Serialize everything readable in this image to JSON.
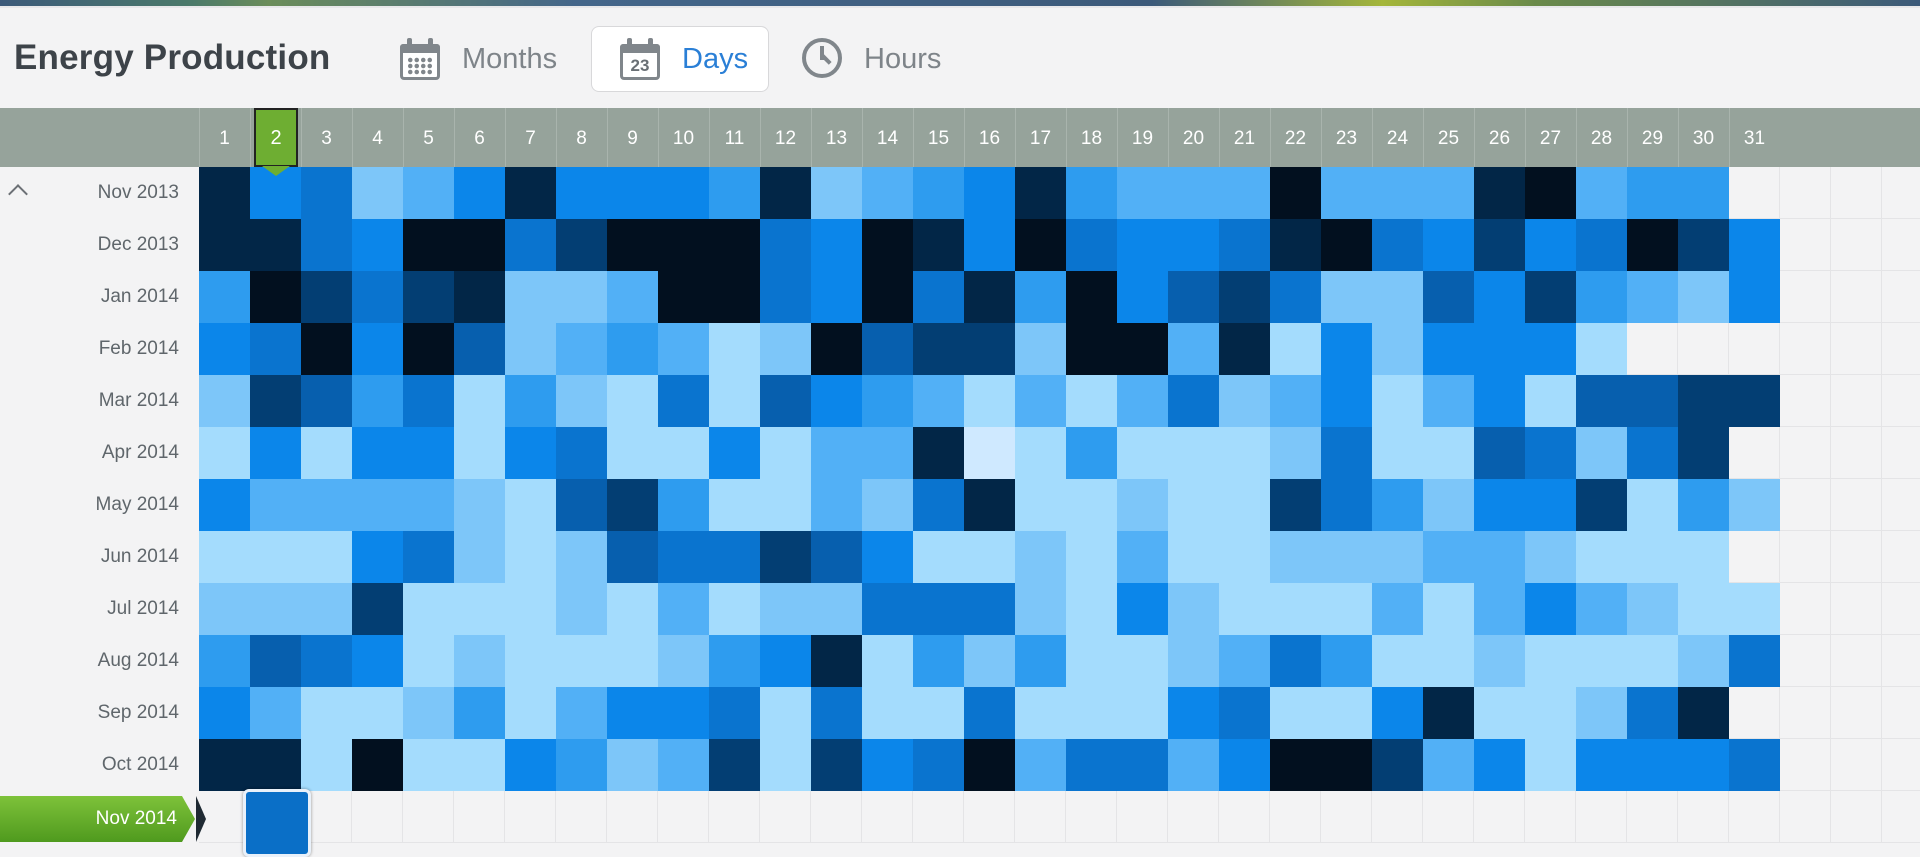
{
  "header": {
    "title": "Energy Production",
    "tabs": [
      {
        "label": "Months",
        "icon": "calendar-grid-icon",
        "active": false
      },
      {
        "label": "Days",
        "icon": "calendar-23-icon",
        "icon_text": "23",
        "active": true
      },
      {
        "label": "Hours",
        "icon": "clock-icon",
        "active": false
      }
    ]
  },
  "days": [
    "1",
    "2",
    "3",
    "4",
    "5",
    "6",
    "7",
    "8",
    "9",
    "10",
    "11",
    "12",
    "13",
    "14",
    "15",
    "16",
    "17",
    "18",
    "19",
    "20",
    "21",
    "22",
    "23",
    "24",
    "25",
    "26",
    "27",
    "28",
    "29",
    "30",
    "31"
  ],
  "selected_day": "2",
  "months": [
    "Nov 2013",
    "Dec 2013",
    "Jan 2014",
    "Feb 2014",
    "Mar 2014",
    "Apr 2014",
    "May 2014",
    "Jun 2014",
    "Jul 2014",
    "Aug 2014",
    "Sep 2014",
    "Oct 2014"
  ],
  "selected_month": "Nov 2014",
  "colors": {
    "accent_green": "#6eae32",
    "active_tab": "#2a7fd6",
    "header_bar": "#96a39b",
    "scale_low": "#cfe9ff",
    "scale_high": "#02101f"
  },
  "chart_data": {
    "type": "heatmap",
    "x": [
      "1",
      "2",
      "3",
      "4",
      "5",
      "6",
      "7",
      "8",
      "9",
      "10",
      "11",
      "12",
      "13",
      "14",
      "15",
      "16",
      "17",
      "18",
      "19",
      "20",
      "21",
      "22",
      "23",
      "24",
      "25",
      "26",
      "27",
      "28",
      "29",
      "30",
      "31"
    ],
    "y": [
      "Nov 2013",
      "Dec 2013",
      "Jan 2014",
      "Feb 2014",
      "Mar 2014",
      "Apr 2014",
      "May 2014",
      "Jun 2014",
      "Jul 2014",
      "Aug 2014",
      "Sep 2014",
      "Oct 2014",
      "Nov 2014"
    ],
    "scale": "intensity 0 (lightest) to 10 (darkest)",
    "values": [
      [
        9,
        5,
        6,
        2,
        3,
        5,
        9,
        5,
        5,
        5,
        4,
        9,
        2,
        3,
        4,
        5,
        9,
        4,
        3,
        3,
        3,
        10,
        3,
        3,
        3,
        9,
        10,
        3,
        4,
        4,
        null
      ],
      [
        9,
        9,
        6,
        5,
        10,
        10,
        6,
        8,
        10,
        10,
        10,
        6,
        5,
        10,
        9,
        5,
        10,
        6,
        5,
        5,
        6,
        9,
        10,
        6,
        5,
        8,
        5,
        6,
        10,
        8,
        5
      ],
      [
        4,
        10,
        8,
        6,
        8,
        9,
        2,
        2,
        3,
        10,
        10,
        6,
        5,
        10,
        6,
        9,
        4,
        10,
        5,
        7,
        8,
        6,
        2,
        2,
        7,
        5,
        8,
        4,
        3,
        2,
        5
      ],
      [
        5,
        6,
        10,
        5,
        10,
        7,
        2,
        3,
        4,
        3,
        1,
        2,
        10,
        7,
        8,
        8,
        2,
        10,
        10,
        3,
        9,
        1,
        5,
        2,
        5,
        5,
        5,
        1,
        null,
        null,
        null
      ],
      [
        2,
        8,
        7,
        4,
        6,
        1,
        4,
        2,
        1,
        6,
        1,
        7,
        5,
        4,
        3,
        1,
        3,
        1,
        3,
        6,
        2,
        3,
        5,
        1,
        3,
        5,
        1,
        7,
        7,
        8,
        8
      ],
      [
        1,
        5,
        1,
        5,
        5,
        1,
        5,
        6,
        1,
        1,
        5,
        1,
        3,
        3,
        9,
        0,
        1,
        4,
        1,
        1,
        1,
        2,
        6,
        1,
        1,
        7,
        6,
        2,
        6,
        8,
        null
      ],
      [
        5,
        3,
        3,
        3,
        3,
        2,
        1,
        7,
        8,
        4,
        1,
        1,
        3,
        2,
        6,
        9,
        1,
        1,
        2,
        1,
        1,
        8,
        6,
        4,
        2,
        5,
        5,
        8,
        1,
        4,
        2
      ],
      [
        1,
        1,
        1,
        5,
        6,
        2,
        1,
        2,
        7,
        6,
        6,
        8,
        7,
        5,
        1,
        1,
        2,
        1,
        3,
        1,
        1,
        2,
        2,
        2,
        3,
        3,
        2,
        1,
        1,
        1,
        null
      ],
      [
        2,
        2,
        2,
        8,
        1,
        1,
        1,
        2,
        1,
        3,
        1,
        2,
        2,
        6,
        6,
        6,
        2,
        1,
        5,
        2,
        1,
        1,
        1,
        3,
        1,
        3,
        5,
        3,
        2,
        1,
        1
      ],
      [
        4,
        7,
        6,
        5,
        1,
        2,
        1,
        1,
        1,
        2,
        4,
        5,
        9,
        1,
        4,
        2,
        4,
        1,
        1,
        2,
        3,
        6,
        4,
        1,
        1,
        2,
        1,
        1,
        1,
        2,
        6
      ],
      [
        5,
        3,
        1,
        1,
        2,
        4,
        1,
        3,
        5,
        5,
        6,
        1,
        6,
        1,
        1,
        6,
        1,
        1,
        1,
        5,
        6,
        1,
        1,
        5,
        9,
        1,
        1,
        2,
        6,
        9,
        null
      ],
      [
        9,
        9,
        1,
        10,
        1,
        1,
        5,
        4,
        2,
        3,
        8,
        1,
        8,
        5,
        6,
        10,
        3,
        6,
        6,
        3,
        5,
        10,
        10,
        8,
        3,
        5,
        1,
        5,
        5,
        5,
        6
      ],
      [
        null,
        6,
        null,
        null,
        null,
        null,
        null,
        null,
        null,
        null,
        null,
        null,
        null,
        null,
        null,
        null,
        null,
        null,
        null,
        null,
        null,
        null,
        null,
        null,
        null,
        null,
        null,
        null,
        null,
        null,
        null
      ]
    ]
  }
}
